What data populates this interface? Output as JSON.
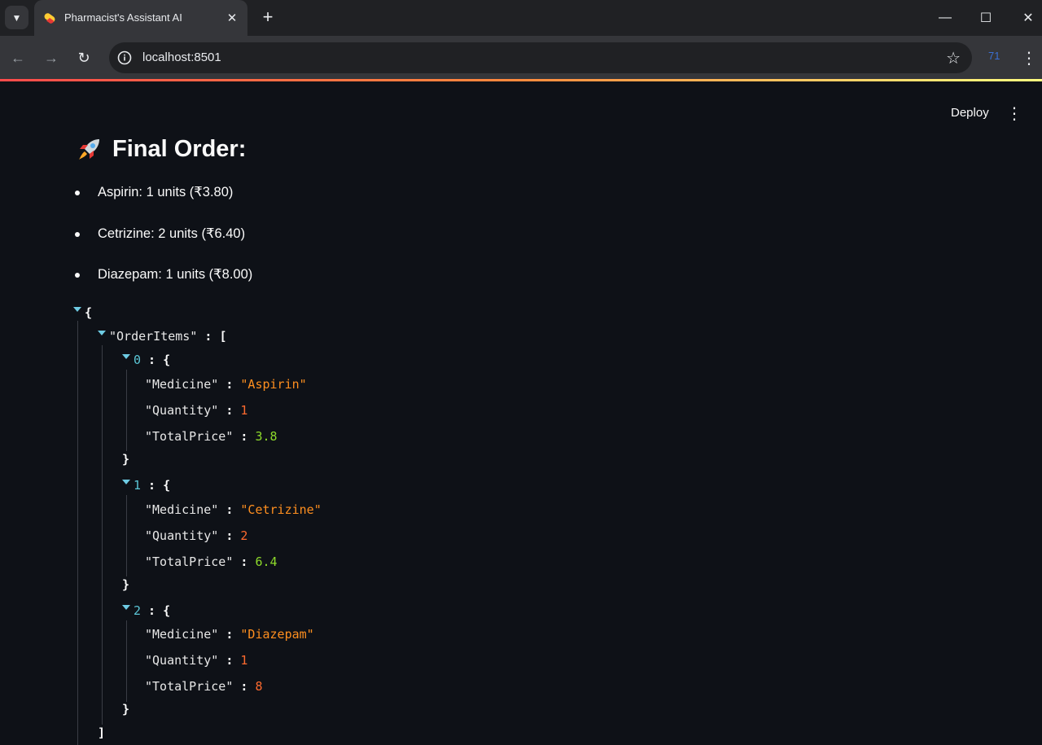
{
  "browser": {
    "tab_title": "Pharmacist's Assistant AI",
    "url": "localhost:8501",
    "extension_badge": "71",
    "icons": {
      "tab_search": "chevron-down-icon",
      "tab_close": "close-icon",
      "new_tab": "plus-icon",
      "back": "arrow-left-icon",
      "forward": "arrow-right-icon",
      "reload": "reload-icon",
      "site_info": "info-icon",
      "bookmark": "star-icon",
      "menu": "kebab-menu-icon"
    }
  },
  "app_header": {
    "deploy_label": "Deploy"
  },
  "main": {
    "heading": "Final Order:",
    "heading_icon": "rocket-icon",
    "order_lines": [
      "Aspirin: 1 units (₹3.80)",
      "Cetrizine: 2 units (₹6.40)",
      "Diazepam: 1 units (₹8.00)"
    ]
  },
  "json_view": {
    "root_key": "\"OrderItems\"",
    "items": [
      {
        "index": "0",
        "medicine_key": "\"Medicine\"",
        "medicine": "\"Aspirin\"",
        "quantity_key": "\"Quantity\"",
        "quantity": "1",
        "price_key": "\"TotalPrice\"",
        "price": "3.8"
      },
      {
        "index": "1",
        "medicine_key": "\"Medicine\"",
        "medicine": "\"Cetrizine\"",
        "quantity_key": "\"Quantity\"",
        "quantity": "2",
        "price_key": "\"TotalPrice\"",
        "price": "6.4"
      },
      {
        "index": "2",
        "medicine_key": "\"Medicine\"",
        "medicine": "\"Diazepam\"",
        "quantity_key": "\"Quantity\"",
        "quantity": "1",
        "price_key": "\"TotalPrice\"",
        "price": "8"
      }
    ]
  },
  "colors": {
    "background": "#0e1117",
    "string_value": "#ff8f1f",
    "int_value": "#ff6a2e",
    "float_value": "#8edb2b",
    "caret": "#6ecbe3"
  }
}
